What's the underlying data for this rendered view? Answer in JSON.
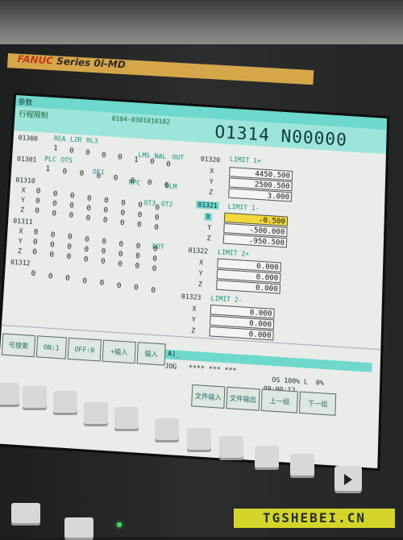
{
  "bezel": {
    "brand": "FANUC",
    "series": "Series 0i-MD"
  },
  "header": {
    "label": "参数",
    "title": "行程限制",
    "param_path": "0104-0301010102",
    "program": "O1314 N00000"
  },
  "params": {
    "p1300": {
      "no": "01300",
      "flags": [
        "REA",
        "LZR",
        "RL3"
      ],
      "values": [
        "1",
        "0",
        "0",
        "0",
        "0",
        "1",
        "0",
        "0"
      ],
      "extra_flags": [
        "LMS",
        "NAL",
        "OUT"
      ]
    },
    "p1301": {
      "no": "01301",
      "flags": [
        "PLC",
        "OTS"
      ],
      "values": [
        "1",
        "0",
        "0",
        "0",
        "0",
        "0",
        "0",
        "0"
      ],
      "extra_flags": [
        "OF1",
        "NPC",
        "DLM"
      ]
    },
    "p1310": {
      "no": "01310",
      "axes": [
        "X",
        "Y",
        "Z"
      ],
      "flags": [
        "OT3",
        "OT2"
      ]
    },
    "p1311": {
      "no": "01311",
      "axes": [
        "X",
        "Y",
        "Z"
      ],
      "flags": [
        "DOT"
      ]
    },
    "p1312": {
      "no": "01312"
    },
    "p1320": {
      "no": "01320",
      "title": "LIMIT 1+",
      "axes": [
        "X",
        "Y",
        "Z"
      ],
      "values": [
        "4450.500",
        "2500.500",
        "3.000"
      ]
    },
    "p1321": {
      "no": "01321",
      "title": "LIMIT 1-",
      "axes": [
        "X",
        "Y",
        "Z"
      ],
      "values": [
        "-0.500",
        "-500.000",
        "-950.500"
      ]
    },
    "p1322": {
      "no": "01322",
      "title": "LIMIT 2+",
      "axes": [
        "X",
        "Y",
        "Z"
      ],
      "values": [
        "0.000",
        "0.000",
        "0.000"
      ]
    },
    "p1323": {
      "no": "01323",
      "title": "LIMIT 2-",
      "axes": [
        "X",
        "Y",
        "Z"
      ],
      "values": [
        "0.000",
        "0.000",
        "0.000"
      ]
    }
  },
  "grid_digit": "0",
  "input": {
    "prompt": "A)_"
  },
  "status": {
    "mode": "JOG",
    "stars": "**** *** ***",
    "os": "OS 100% L",
    "pct": "0%",
    "time": "09:00:12"
  },
  "softkeys": {
    "row1": [
      "号搜索",
      "ON:1",
      "OFF:0",
      "+输入",
      "输入"
    ],
    "row2": [
      "文件输入",
      "文件输出",
      "上一组",
      "下一组"
    ]
  },
  "watermark": "TGSHEBEI.CN"
}
